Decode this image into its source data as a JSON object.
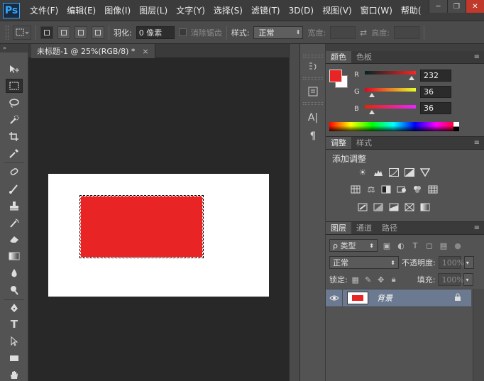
{
  "app": {
    "logo": "Ps"
  },
  "menu": [
    "文件(F)",
    "编辑(E)",
    "图像(I)",
    "图层(L)",
    "文字(Y)",
    "选择(S)",
    "滤镜(T)",
    "3D(D)",
    "视图(V)",
    "窗口(W)",
    "帮助("
  ],
  "window_controls": {
    "minimize": "─",
    "restore": "❐",
    "close": "✕"
  },
  "options": {
    "feather_label": "羽化:",
    "feather_value": "0 像素",
    "antialias_label": "消除锯齿",
    "style_label": "样式:",
    "style_value": "正常",
    "width_label": "宽度:",
    "height_label": "高度:"
  },
  "document": {
    "tab_title": "未标题-1 @ 25%(RGB/8) *",
    "close": "×"
  },
  "color_panel": {
    "tabs": [
      "颜色",
      "色板"
    ],
    "channels": [
      {
        "label": "R",
        "value": "232",
        "fraction": 0.91
      },
      {
        "label": "G",
        "value": "36",
        "fraction": 0.14
      },
      {
        "label": "B",
        "value": "36",
        "fraction": 0.14
      }
    ],
    "foreground": "#e82424",
    "background": "#ffffff"
  },
  "adjustments_panel": {
    "tabs": [
      "调整",
      "样式"
    ],
    "title": "添加调整"
  },
  "layers_panel": {
    "tabs": [
      "图层",
      "通道",
      "路径"
    ],
    "filter_label": "ρ 类型",
    "blend_mode": "正常",
    "opacity_label": "不透明度:",
    "opacity_value": "100%",
    "lock_label": "锁定:",
    "fill_label": "填充:",
    "fill_value": "100%",
    "layers": [
      {
        "name": "背景",
        "locked": true,
        "visible": true
      }
    ]
  },
  "colors": {
    "selection_fill": "#e82424",
    "canvas": "#ffffff",
    "pasteboard": "#282828"
  }
}
